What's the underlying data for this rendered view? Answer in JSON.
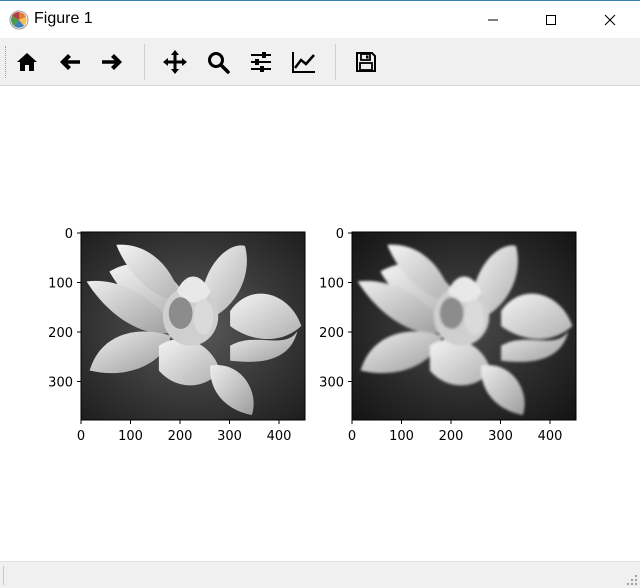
{
  "window": {
    "title": "Figure 1",
    "controls": [
      "minimize",
      "maximize",
      "close"
    ]
  },
  "toolbar": {
    "buttons": [
      {
        "name": "home",
        "icon": "home-icon"
      },
      {
        "name": "back",
        "icon": "arrow-left-icon"
      },
      {
        "name": "forward",
        "icon": "arrow-right-icon"
      },
      {
        "name": "pan",
        "icon": "move-icon"
      },
      {
        "name": "zoom",
        "icon": "magnifier-icon"
      },
      {
        "name": "configure-subplots",
        "icon": "sliders-icon"
      },
      {
        "name": "edit-axes",
        "icon": "line-chart-icon"
      },
      {
        "name": "save",
        "icon": "floppy-disk-icon"
      }
    ]
  },
  "figure": {
    "axes": [
      {
        "image": "grayscale lotus flower",
        "x_ticks": [
          "0",
          "100",
          "200",
          "300",
          "400"
        ],
        "y_ticks": [
          "0",
          "100",
          "200",
          "300"
        ]
      },
      {
        "image": "smoothed grayscale lotus flower",
        "x_ticks": [
          "0",
          "100",
          "200",
          "300",
          "400"
        ],
        "y_ticks": [
          "0",
          "100",
          "200",
          "300"
        ]
      }
    ]
  },
  "colors": {
    "titlebar_border": "#3c7fb1",
    "toolbar_bg": "#f0f0f0",
    "statusbar_bg": "#f0f0f0"
  }
}
